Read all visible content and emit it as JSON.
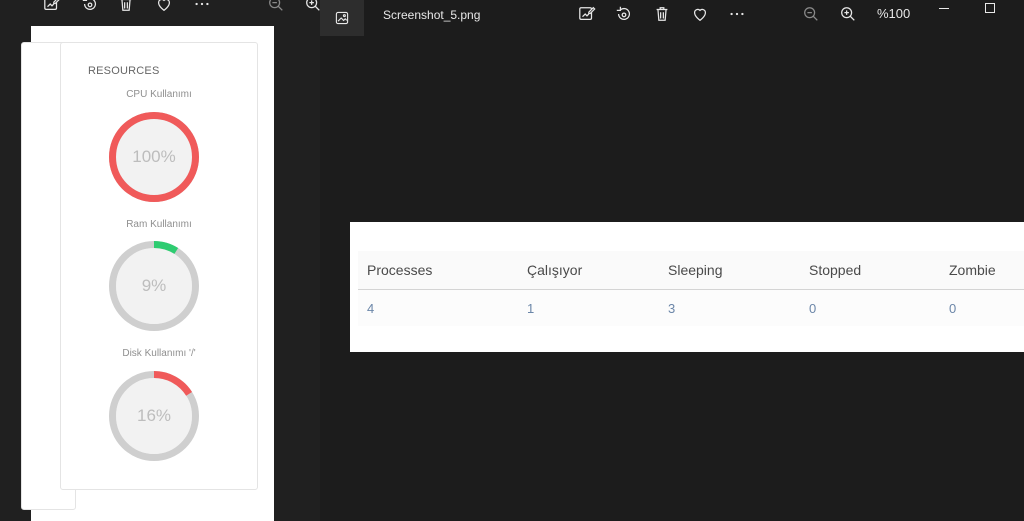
{
  "left_viewer": {
    "toolbar_icons": [
      "edit-image-icon",
      "rotate-icon",
      "delete-icon",
      "favorite-icon",
      "more-icon",
      "zoom-out-icon",
      "zoom-in-icon"
    ],
    "resources": {
      "title": "RESOURCES",
      "gauges": [
        {
          "label": "CPU Kullanımı",
          "value_text": "100%",
          "percent": 100,
          "color": "#f05a5a"
        },
        {
          "label": "Ram Kullanımı",
          "value_text": "9%",
          "percent": 9,
          "color": "#2ecc71"
        },
        {
          "label": "Disk Kullanımı '/'",
          "value_text": "16%",
          "percent": 16,
          "color": "#f05a5a"
        }
      ]
    }
  },
  "right_viewer": {
    "file_name": "Screenshot_5.png",
    "zoom_level": "%100",
    "toolbar_icons": [
      "edit-image-icon",
      "rotate-icon",
      "delete-icon",
      "favorite-icon",
      "more-icon",
      "zoom-out-icon",
      "zoom-in-icon"
    ],
    "process_table": {
      "headers": [
        "Processes",
        "Çalışıyor",
        "Sleeping",
        "Stopped",
        "Zombie"
      ],
      "row": [
        "4",
        "1",
        "3",
        "0",
        "0"
      ]
    }
  },
  "colors": {
    "window_bg": "#1f1f1f",
    "gauge_track": "#cfcfcf",
    "gauge_inner": "#f2f2f2",
    "table_value": "#6b86a8"
  }
}
